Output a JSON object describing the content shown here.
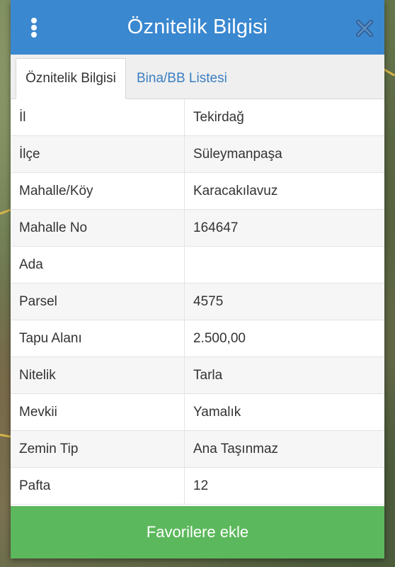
{
  "dialog": {
    "title": "Öznitelik Bilgisi",
    "menu_icon": "kebab-menu-icon",
    "close_icon": "close-icon"
  },
  "tabs": [
    {
      "label": "Öznitelik Bilgisi",
      "active": true
    },
    {
      "label": "Bina/BB Listesi",
      "active": false
    }
  ],
  "attributes": [
    {
      "key": "İl",
      "value": "Tekirdağ"
    },
    {
      "key": "İlçe",
      "value": "Süleymanpaşa"
    },
    {
      "key": "Mahalle/Köy",
      "value": "Karacakılavuz"
    },
    {
      "key": "Mahalle No",
      "value": "164647"
    },
    {
      "key": "Ada",
      "value": ""
    },
    {
      "key": "Parsel",
      "value": "4575"
    },
    {
      "key": "Tapu Alanı",
      "value": "2.500,00"
    },
    {
      "key": "Nitelik",
      "value": "Tarla"
    },
    {
      "key": "Mevkii",
      "value": "Yamalık"
    },
    {
      "key": "Zemin Tip",
      "value": "Ana Taşınmaz"
    },
    {
      "key": "Pafta",
      "value": "12"
    }
  ],
  "actions": {
    "favorite_label": "Favorilere ekle"
  },
  "colors": {
    "header": "#3a88d0",
    "tab_link": "#3a7fc1",
    "favorite_button": "#5cb85c"
  }
}
